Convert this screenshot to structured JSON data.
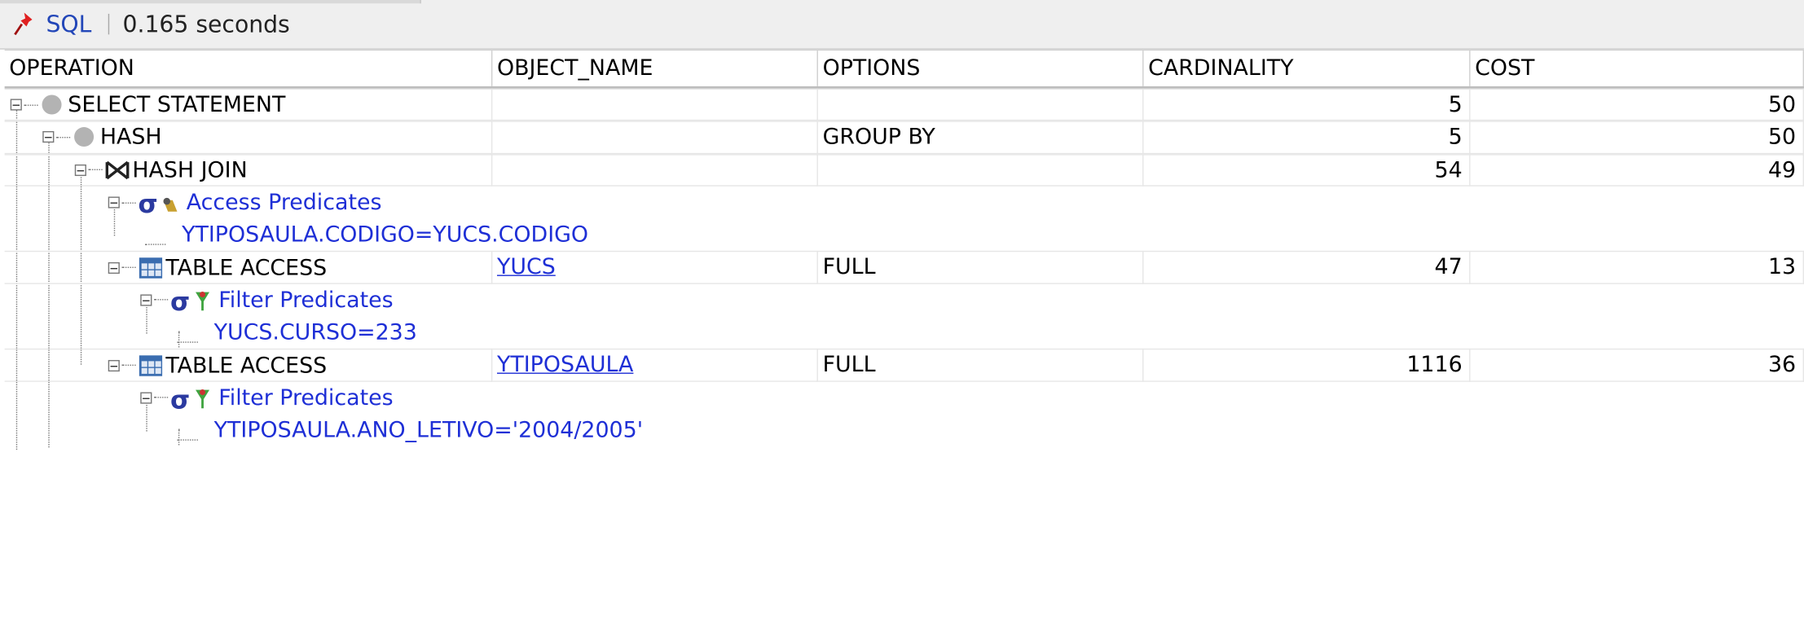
{
  "toolbar": {
    "sql_label": "SQL",
    "time": "0.165 seconds"
  },
  "columns": [
    "OPERATION",
    "OBJECT_NAME",
    "OPTIONS",
    "CARDINALITY",
    "COST"
  ],
  "rows": [
    {
      "op": "SELECT STATEMENT",
      "object": "",
      "options": "",
      "cardinality": "5",
      "cost": "50"
    },
    {
      "op": "HASH",
      "object": "",
      "options": "GROUP BY",
      "cardinality": "5",
      "cost": "50"
    },
    {
      "op": "HASH JOIN",
      "object": "",
      "options": "",
      "cardinality": "54",
      "cost": "49"
    },
    {
      "label": "Access Predicates"
    },
    {
      "text": "YTIPOSAULA.CODIGO=YUCS.CODIGO"
    },
    {
      "op": "TABLE ACCESS",
      "object": "YUCS",
      "options": "FULL",
      "cardinality": "47",
      "cost": "13"
    },
    {
      "label": "Filter Predicates"
    },
    {
      "text": "YUCS.CURSO=233"
    },
    {
      "op": "TABLE ACCESS",
      "object": "YTIPOSAULA",
      "options": "FULL",
      "cardinality": "1116",
      "cost": "36"
    },
    {
      "label": "Filter Predicates"
    },
    {
      "text": "YTIPOSAULA.ANO_LETIVO='2004/2005'"
    }
  ]
}
